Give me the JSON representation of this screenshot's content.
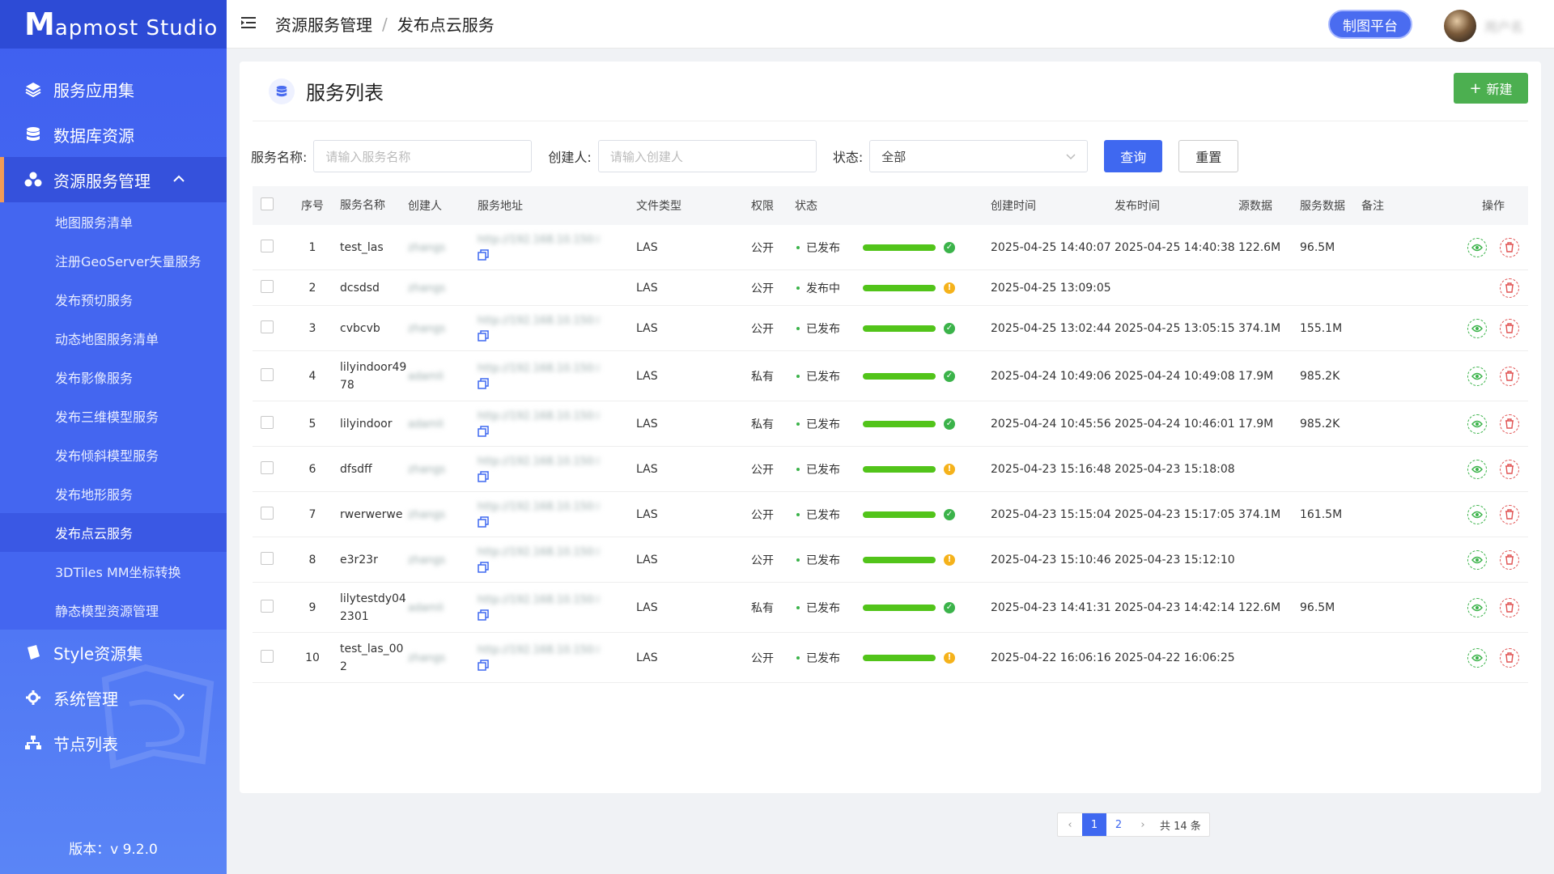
{
  "app": {
    "logo_letter": "M",
    "logo_text": "apmost Studio",
    "version_label": "版本：",
    "version": "v 9.2.0"
  },
  "sidebar": {
    "menu": [
      {
        "label": "服务应用集",
        "icon": "layers-icon"
      },
      {
        "label": "数据库资源",
        "icon": "database-icon"
      },
      {
        "label": "资源服务管理",
        "icon": "cluster-icon",
        "active": true,
        "expanded": true
      },
      {
        "label": "Style资源集",
        "icon": "style-icon"
      },
      {
        "label": "系统管理",
        "icon": "gear-icon",
        "collapsed": true
      },
      {
        "label": "节点列表",
        "icon": "network-icon"
      }
    ],
    "submenu": [
      {
        "label": "地图服务清单"
      },
      {
        "label": "注册GeoServer矢量服务"
      },
      {
        "label": "发布预切服务"
      },
      {
        "label": "动态地图服务清单"
      },
      {
        "label": "发布影像服务"
      },
      {
        "label": "发布三维模型服务"
      },
      {
        "label": "发布倾斜模型服务"
      },
      {
        "label": "发布地形服务"
      },
      {
        "label": "发布点云服务",
        "active": true
      },
      {
        "label": "3DTiles MM坐标转换"
      },
      {
        "label": "静态模型资源管理"
      }
    ]
  },
  "header": {
    "breadcrumb": [
      "资源服务管理",
      "发布点云服务"
    ],
    "breadcrumb_sep": "/",
    "map_platform_label": "制图平台",
    "username": "用户名"
  },
  "card": {
    "title": "服务列表",
    "new_button": "新建",
    "new_icon": "+"
  },
  "filters": {
    "name_label": "服务名称:",
    "name_placeholder": "请输入服务名称",
    "creator_label": "创建人:",
    "creator_placeholder": "请输入创建人",
    "status_label": "状态:",
    "status_value": "全部",
    "query_button": "查询",
    "reset_button": "重置"
  },
  "table": {
    "columns": [
      "序号",
      "服务名称",
      "创建人",
      "服务地址",
      "文件类型",
      "权限",
      "状态",
      "创建时间",
      "发布时间",
      "源数据",
      "服务数据",
      "备注",
      "操作"
    ],
    "rows": [
      {
        "no": "1",
        "name": "test_las",
        "creator": "zhangs",
        "addr": "http://192.168.10.150:8080/",
        "has_addr": true,
        "type": "LAS",
        "perm": "公开",
        "status": "已发布",
        "state": "ok",
        "ctime": "2025-04-25 14:40:07",
        "ptime": "2025-04-25 14:40:38",
        "src": "122.6M",
        "srv": "96.5M",
        "note": "",
        "view": true,
        "progress": 100
      },
      {
        "no": "2",
        "name": "dcsdsd",
        "creator": "zhangs",
        "addr": "",
        "has_addr": false,
        "type": "LAS",
        "perm": "公开",
        "status": "发布中",
        "state": "warn",
        "ctime": "2025-04-25 13:09:05",
        "ptime": "",
        "src": "",
        "srv": "",
        "note": "",
        "view": false,
        "progress": 100
      },
      {
        "no": "3",
        "name": "cvbcvb",
        "creator": "zhangs",
        "addr": "http://192.168.10.150:8080/",
        "has_addr": true,
        "type": "LAS",
        "perm": "公开",
        "status": "已发布",
        "state": "ok",
        "ctime": "2025-04-25 13:02:44",
        "ptime": "2025-04-25 13:05:15",
        "src": "374.1M",
        "srv": "155.1M",
        "note": "",
        "view": true,
        "progress": 100
      },
      {
        "no": "4",
        "name": "lilyindoor4978",
        "creator": "adamli",
        "addr": "http://192.168.10.150:8080/",
        "has_addr": true,
        "type": "LAS",
        "perm": "私有",
        "status": "已发布",
        "state": "ok",
        "ctime": "2025-04-24 10:49:06",
        "ptime": "2025-04-24 10:49:08",
        "src": "17.9M",
        "srv": "985.2K",
        "note": "",
        "view": true,
        "progress": 100
      },
      {
        "no": "5",
        "name": "lilyindoor",
        "creator": "adamli",
        "addr": "http://192.168.10.150:8080/",
        "has_addr": true,
        "type": "LAS",
        "perm": "私有",
        "status": "已发布",
        "state": "ok",
        "ctime": "2025-04-24 10:45:56",
        "ptime": "2025-04-24 10:46:01",
        "src": "17.9M",
        "srv": "985.2K",
        "note": "",
        "view": true,
        "progress": 100
      },
      {
        "no": "6",
        "name": "dfsdff",
        "creator": "zhangs",
        "addr": "http://192.168.10.150:8080/",
        "has_addr": true,
        "type": "LAS",
        "perm": "公开",
        "status": "已发布",
        "state": "warn",
        "ctime": "2025-04-23 15:16:48",
        "ptime": "2025-04-23 15:18:08",
        "src": "",
        "srv": "",
        "note": "",
        "view": true,
        "progress": 100
      },
      {
        "no": "7",
        "name": "rwerwerwe",
        "creator": "zhangs",
        "addr": "http://192.168.10.150:8080/",
        "has_addr": true,
        "type": "LAS",
        "perm": "公开",
        "status": "已发布",
        "state": "ok",
        "ctime": "2025-04-23 15:15:04",
        "ptime": "2025-04-23 15:17:05",
        "src": "374.1M",
        "srv": "161.5M",
        "note": "",
        "view": true,
        "progress": 100
      },
      {
        "no": "8",
        "name": "e3r23r",
        "creator": "zhangs",
        "addr": "http://192.168.10.150:8080/",
        "has_addr": true,
        "type": "LAS",
        "perm": "公开",
        "status": "已发布",
        "state": "warn",
        "ctime": "2025-04-23 15:10:46",
        "ptime": "2025-04-23 15:12:10",
        "src": "",
        "srv": "",
        "note": "",
        "view": true,
        "progress": 100
      },
      {
        "no": "9",
        "name": "lilytestdy042301",
        "creator": "adamli",
        "addr": "http://192.168.10.150:8080/",
        "has_addr": true,
        "type": "LAS",
        "perm": "私有",
        "status": "已发布",
        "state": "ok",
        "ctime": "2025-04-23 14:41:31",
        "ptime": "2025-04-23 14:42:14",
        "src": "122.6M",
        "srv": "96.5M",
        "note": "",
        "view": true,
        "progress": 100
      },
      {
        "no": "10",
        "name": "test_las_002",
        "creator": "zhangs",
        "addr": "http://192.168.10.150:8080/",
        "has_addr": true,
        "type": "LAS",
        "perm": "公开",
        "status": "已发布",
        "state": "warn",
        "ctime": "2025-04-22 16:06:16",
        "ptime": "2025-04-22 16:06:25",
        "src": "",
        "srv": "",
        "note": "",
        "view": true,
        "progress": 100
      }
    ]
  },
  "pagination": {
    "prev": "‹",
    "pages": [
      "1",
      "2"
    ],
    "current": "1",
    "next": "›",
    "total_text": "共 14 条"
  },
  "colors": {
    "sidebar": "#4466f0",
    "primary": "#3f68f0",
    "success": "#52c41a",
    "warning": "#f5b21b",
    "danger": "#e15353",
    "new_button": "#4caf50"
  }
}
